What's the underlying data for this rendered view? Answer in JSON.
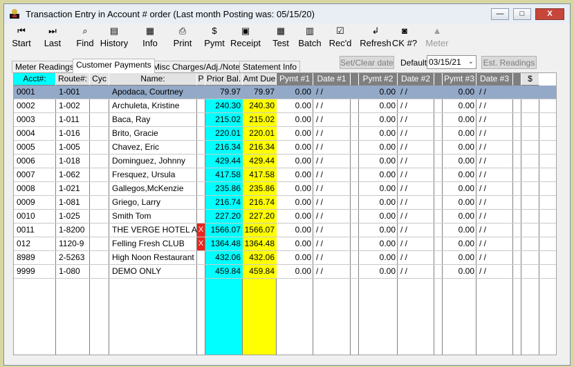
{
  "window": {
    "title": "Transaction Entry in Account # order (Last month Posting was: 05/15/20)",
    "min_label": "—",
    "max_label": "□",
    "close_label": "X"
  },
  "toolbar": [
    {
      "key": "start",
      "label": "Start",
      "icon": "first-record-icon",
      "glyph": "⏮"
    },
    {
      "key": "last",
      "label": "Last",
      "icon": "last-record-icon",
      "glyph": "⏭"
    },
    {
      "key": "find",
      "label": "Find",
      "icon": "search-icon",
      "glyph": "⌕"
    },
    {
      "key": "history",
      "label": "History",
      "icon": "history-icon",
      "glyph": "▤"
    },
    {
      "key": "info",
      "label": "Info",
      "icon": "calendar-icon",
      "glyph": "▦"
    },
    {
      "key": "print",
      "label": "Print",
      "icon": "printer-icon",
      "glyph": "⎙"
    },
    {
      "key": "pymt",
      "label": "Pymt",
      "icon": "dollar-icon",
      "glyph": "$"
    },
    {
      "key": "receipt",
      "label": "Receipt",
      "icon": "receipt-icon",
      "glyph": "▣"
    },
    {
      "key": "test",
      "label": "Test",
      "icon": "calculator-icon",
      "glyph": "▦"
    },
    {
      "key": "batch",
      "label": "Batch",
      "icon": "batch-icon",
      "glyph": "▥"
    },
    {
      "key": "recd",
      "label": "Rec'd",
      "icon": "received-icon",
      "glyph": "☑"
    },
    {
      "key": "refresh",
      "label": "Refresh",
      "icon": "refresh-icon",
      "glyph": "↲"
    },
    {
      "key": "ck",
      "label": "CK #?",
      "icon": "camera-icon",
      "glyph": "◙"
    },
    {
      "key": "meter",
      "label": "Meter",
      "icon": "meter-icon",
      "glyph": "▲",
      "disabled": true
    }
  ],
  "tabs": [
    {
      "label": "Meter Readings",
      "active": false
    },
    {
      "label": "Customer Payments",
      "active": true
    },
    {
      "label": "Misc Charges/Adj./Notes",
      "active": false
    },
    {
      "label": "Statement Info",
      "active": false
    }
  ],
  "controls": {
    "set_clear_date": "Set/Clear date",
    "default_label": "Default:",
    "default_date": "03/15/21",
    "est_readings": "Est. Readings"
  },
  "columns": [
    "Acct#:",
    "Route#:",
    "Cyc",
    "Name:",
    "P",
    "Prior Bal.",
    "Amt Due",
    "Pymt #1",
    "Date #1",
    "",
    "Pymt #2",
    "Date #2",
    "",
    "Pymt #3",
    "Date #3",
    "",
    "$"
  ],
  "rows": [
    {
      "acct": "0001",
      "route": "1-001",
      "name": "Apodaca, Courtney",
      "flag": "",
      "prior": "79.97",
      "due": "79.97",
      "p1": "0.00",
      "d1": "/ /",
      "p2": "0.00",
      "d2": "/ /",
      "p3": "0.00",
      "d3": "/ /",
      "selected": true
    },
    {
      "acct": "0002",
      "route": "1-002",
      "name": "Archuleta, Kristine",
      "flag": "",
      "prior": "240.30",
      "due": "240.30",
      "p1": "0.00",
      "d1": "/ /",
      "p2": "0.00",
      "d2": "/ /",
      "p3": "0.00",
      "d3": "/ /"
    },
    {
      "acct": "0003",
      "route": "1-011",
      "name": "Baca, Ray",
      "flag": "",
      "prior": "215.02",
      "due": "215.02",
      "p1": "0.00",
      "d1": "/ /",
      "p2": "0.00",
      "d2": "/ /",
      "p3": "0.00",
      "d3": "/ /"
    },
    {
      "acct": "0004",
      "route": "1-016",
      "name": "Brito, Gracie",
      "flag": "",
      "prior": "220.01",
      "due": "220.01",
      "p1": "0.00",
      "d1": "/ /",
      "p2": "0.00",
      "d2": "/ /",
      "p3": "0.00",
      "d3": "/ /"
    },
    {
      "acct": "0005",
      "route": "1-005",
      "name": "Chavez, Eric",
      "flag": "",
      "prior": "216.34",
      "due": "216.34",
      "p1": "0.00",
      "d1": "/ /",
      "p2": "0.00",
      "d2": "/ /",
      "p3": "0.00",
      "d3": "/ /"
    },
    {
      "acct": "0006",
      "route": "1-018",
      "name": "Dominguez, Johnny",
      "flag": "",
      "prior": "429.44",
      "due": "429.44",
      "p1": "0.00",
      "d1": "/ /",
      "p2": "0.00",
      "d2": "/ /",
      "p3": "0.00",
      "d3": "/ /"
    },
    {
      "acct": "0007",
      "route": "1-062",
      "name": "Fresquez, Ursula",
      "flag": "",
      "prior": "417.58",
      "due": "417.58",
      "p1": "0.00",
      "d1": "/ /",
      "p2": "0.00",
      "d2": "/ /",
      "p3": "0.00",
      "d3": "/ /"
    },
    {
      "acct": "0008",
      "route": "1-021",
      "name": "Gallegos,McKenzie",
      "flag": "",
      "prior": "235.86",
      "due": "235.86",
      "p1": "0.00",
      "d1": "/ /",
      "p2": "0.00",
      "d2": "/ /",
      "p3": "0.00",
      "d3": "/ /"
    },
    {
      "acct": "0009",
      "route": "1-081",
      "name": "Griego, Larry",
      "flag": "",
      "prior": "216.74",
      "due": "216.74",
      "p1": "0.00",
      "d1": "/ /",
      "p2": "0.00",
      "d2": "/ /",
      "p3": "0.00",
      "d3": "/ /"
    },
    {
      "acct": "0010",
      "route": "1-025",
      "name": "Smith Tom",
      "flag": "",
      "prior": "227.20",
      "due": "227.20",
      "p1": "0.00",
      "d1": "/ /",
      "p2": "0.00",
      "d2": "/ /",
      "p3": "0.00",
      "d3": "/ /"
    },
    {
      "acct": "0011",
      "route": "1-8200",
      "name": "THE VERGE HOTEL AND",
      "flag": "X",
      "prior": "1566.07",
      "due": "1566.07",
      "p1": "0.00",
      "d1": "/ /",
      "p2": "0.00",
      "d2": "/ /",
      "p3": "0.00",
      "d3": "/ /"
    },
    {
      "acct": "012",
      "route": "1120-9",
      "name": "Felling Fresh CLUB",
      "flag": "X",
      "prior": "1364.48",
      "due": "1364.48",
      "p1": "0.00",
      "d1": "/ /",
      "p2": "0.00",
      "d2": "/ /",
      "p3": "0.00",
      "d3": "/ /"
    },
    {
      "acct": "8989",
      "route": "2-5263",
      "name": "High Noon Restaurant",
      "flag": "",
      "prior": "432.06",
      "due": "432.06",
      "p1": "0.00",
      "d1": "/ /",
      "p2": "0.00",
      "d2": "/ /",
      "p3": "0.00",
      "d3": "/ /"
    },
    {
      "acct": "9999",
      "route": "1-080",
      "name": "DEMO ONLY",
      "flag": "",
      "prior": "459.84",
      "due": "459.84",
      "p1": "0.00",
      "d1": "/ /",
      "p2": "0.00",
      "d2": "/ /",
      "p3": "0.00",
      "d3": "/ /"
    }
  ],
  "colors": {
    "prior_bal_bg": "#00ffff",
    "amt_due_bg": "#ffff00",
    "selected_row": "#93a9c7",
    "flag_red": "#e8261f"
  }
}
